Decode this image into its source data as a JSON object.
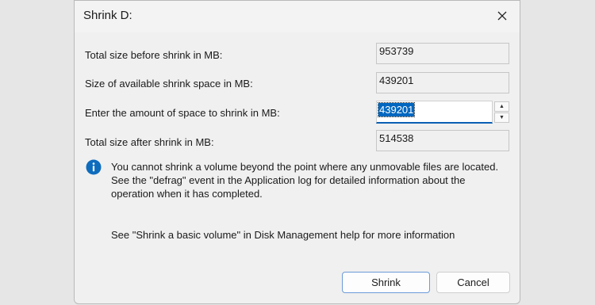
{
  "dialog": {
    "title": "Shrink D:",
    "close_icon": "close-icon"
  },
  "fields": {
    "total_before_label": "Total size before shrink in MB:",
    "total_before_value": "953739",
    "available_label": "Size of available shrink space in MB:",
    "available_value": "439201",
    "amount_label": "Enter the amount of space to shrink in MB:",
    "amount_value": "439201",
    "total_after_label": "Total size after shrink in MB:",
    "total_after_value": "514538"
  },
  "info": {
    "icon": "info-icon",
    "text": "You cannot shrink a volume beyond the point where any unmovable files are located. See the \"defrag\" event in the Application log for detailed information about the operation when it has completed."
  },
  "help": {
    "text": "See \"Shrink a basic volume\" in Disk Management help for more information"
  },
  "buttons": {
    "shrink_label": "Shrink",
    "cancel_label": "Cancel"
  },
  "colors": {
    "accent": "#0067c0",
    "info_icon": "#0f6cbd",
    "dialog_bg": "#f0f0f0"
  }
}
